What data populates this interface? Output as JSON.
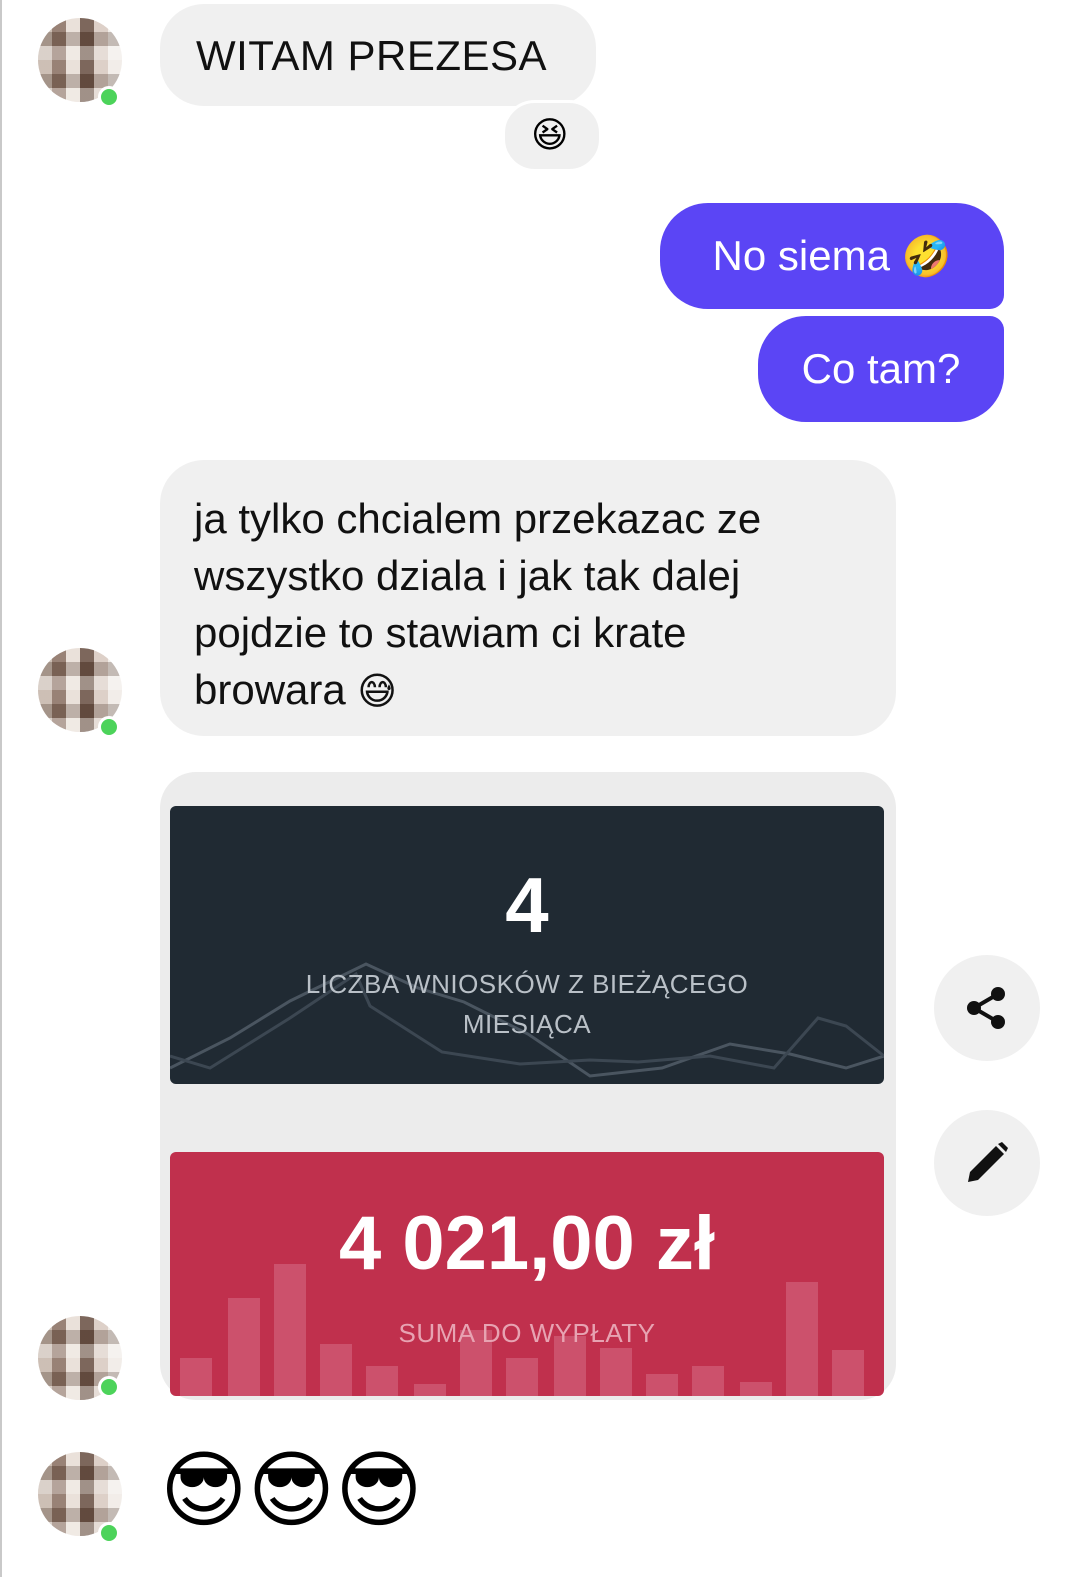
{
  "messages": {
    "greeting": "WITAM PREZESA",
    "greeting_reaction": "😆",
    "out_1": "No siema",
    "out_1_emoji": "🤣",
    "out_2": "Co tam?",
    "long_line_1": "ja tylko chcialem przekazac ze",
    "long_line_2": "wszystko dziala i jak tak dalej",
    "long_line_3": "pojdzie to stawiam ci krate",
    "long_line_4": "browara",
    "long_emoji": "😅",
    "final_emojis": [
      "😎",
      "😎",
      "😎"
    ]
  },
  "card": {
    "stat_value": "4",
    "stat_label_line1": "LICZBA WNIOSKÓW Z BIEŻĄCEGO",
    "stat_label_line2": "MIESIĄCA",
    "amount_value": "4 021,00 zł",
    "amount_label": "SUMA DO WYPŁATY"
  },
  "actions": {
    "share_icon": "share-icon",
    "edit_icon": "pencil-icon"
  },
  "colors": {
    "outgoing_bubble": "#5b45f5",
    "incoming_bubble": "#f0f0f0",
    "dark_panel": "#202a33",
    "red_panel": "#c0304d",
    "presence": "#4cd35a"
  }
}
